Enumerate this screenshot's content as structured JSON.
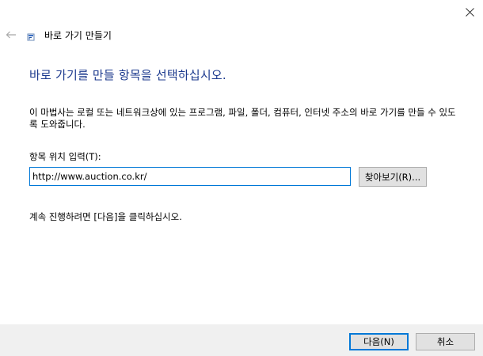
{
  "window": {
    "title": "바로 가기 만들기",
    "close_icon": "close-icon",
    "back_icon": "back-arrow-icon",
    "title_icon": "shortcut-icon"
  },
  "main": {
    "heading": "바로 가기를 만들 항목을 선택하십시오.",
    "description": "이 마법사는 로컬 또는 네트워크상에 있는 프로그램, 파일, 폴더, 컴퓨터, 인터넷 주소의 바로 가기를 만들 수 있도록 도와줍니다.",
    "input_label": "항목 위치 입력(T):",
    "location_value": "http://www.auction.co.kr/",
    "browse_label": "찾아보기(R)...",
    "instruction": "계속 진행하려면 [다음]을 클릭하십시오."
  },
  "footer": {
    "next_label": "다음(N)",
    "cancel_label": "취소"
  },
  "colors": {
    "heading": "#1c3a8e",
    "focus_border": "#0078d7",
    "footer_bg": "#f0f0f0",
    "button_bg": "#e1e1e1"
  }
}
